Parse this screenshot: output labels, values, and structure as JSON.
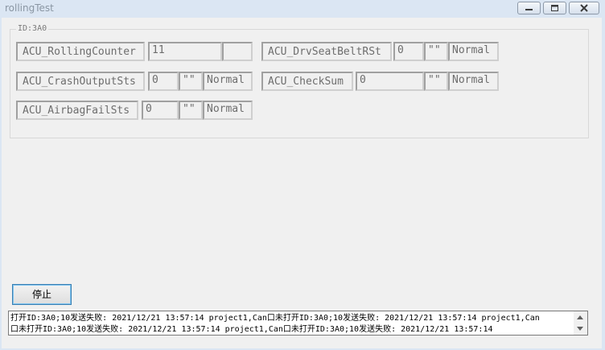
{
  "window": {
    "title": "rollingTest"
  },
  "group": {
    "label": "ID:3A0"
  },
  "signals": [
    {
      "name": "ACU_RollingCounter",
      "value": "11",
      "unit": "",
      "status": ""
    },
    {
      "name": "ACU_DrvSeatBeltRSt",
      "value": "0",
      "unit": "\"\"",
      "status": "Normal"
    },
    {
      "name": "ACU_CrashOutputSts",
      "value": "0",
      "unit": "\"\"",
      "status": "Normal"
    },
    {
      "name": "ACU_CheckSum",
      "value": "0",
      "unit": "\"\"",
      "status": "Normal"
    },
    {
      "name": "ACU_AirbagFailSts",
      "value": "0",
      "unit": "\"\"",
      "status": "Normal"
    }
  ],
  "controls": {
    "stop_label": "停止"
  },
  "log": {
    "line1": "打开ID:3A0;10发送失败: 2021/12/21 13:57:14 project1,Can口未打开ID:3A0;10发送失败: 2021/12/21 13:57:14 project1,Can",
    "line2": "口未打开ID:3A0;10发送失败: 2021/12/21 13:57:14 project1,Can口未打开ID:3A0;10发送失败: 2021/12/21 13:57:14"
  }
}
